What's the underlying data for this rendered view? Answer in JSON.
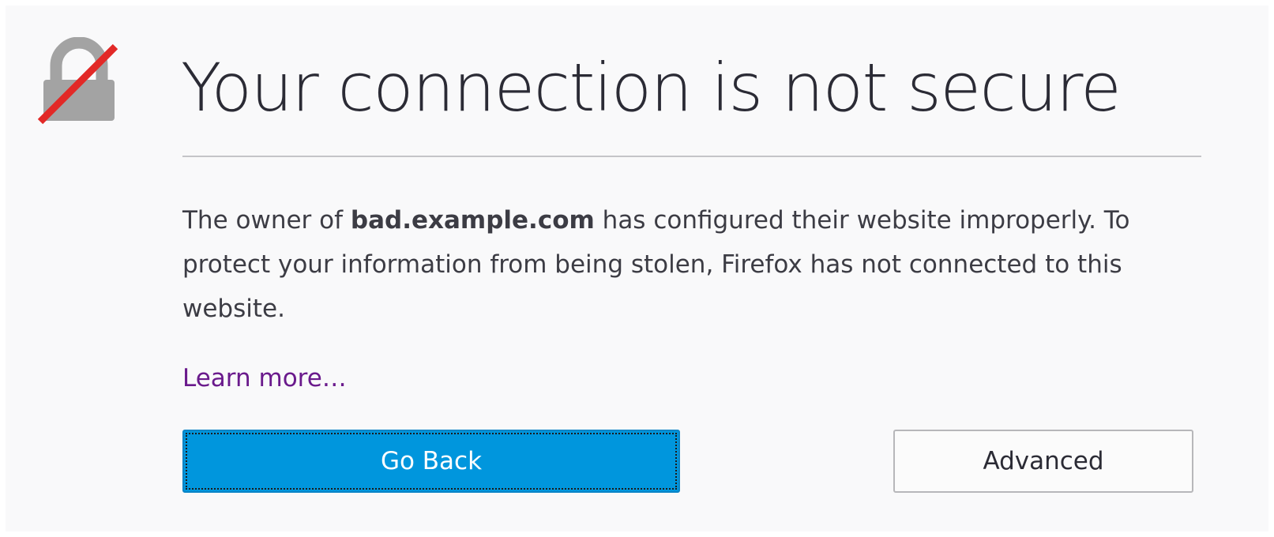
{
  "error_page": {
    "icon": "broken-lock-icon",
    "title": "Your connection is not secure",
    "description": {
      "prefix": "The owner of ",
      "domain": "bad.example.com",
      "suffix": " has configured their website improperly. To protect your information from being stolen, Firefox has not connected to this website."
    },
    "learn_more": "Learn more…",
    "go_back_label": "Go Back",
    "advanced_label": "Advanced"
  },
  "colors": {
    "background": "#f9f9fa",
    "primary_button": "#0096dd",
    "link": "#6a1a8c",
    "lock_gray": "#a3a3a3",
    "slash_red": "#e22927"
  }
}
